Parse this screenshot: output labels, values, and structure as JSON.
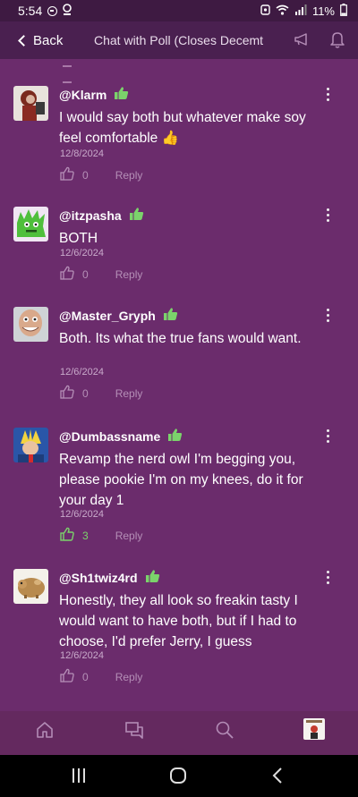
{
  "status": {
    "time": "5:54",
    "battery": "11%"
  },
  "appbar": {
    "back_label": "Back",
    "title": "Chat with Poll (Closes Decemt"
  },
  "comments": [
    {
      "username": "@Klarm",
      "text": "I would say both but whatever make soy feel comfortable 👍",
      "date": "12/8/2024",
      "likes": "0",
      "reply": "Reply",
      "liked": false
    },
    {
      "username": "@itzpasha",
      "text": "BOTH",
      "date": "12/6/2024",
      "likes": "0",
      "reply": "Reply",
      "liked": false
    },
    {
      "username": "@Master_Gryph",
      "text": "Both. Its what the true fans would want.",
      "date": "12/6/2024",
      "likes": "0",
      "reply": "Reply",
      "liked": false
    },
    {
      "username": "@Dumbassname",
      "text": "Revamp the nerd owl I'm begging you, please pookie I'm on my knees, do it for your day 1",
      "date": "12/6/2024",
      "likes": "3",
      "reply": "Reply",
      "liked": true
    },
    {
      "username": "@Sh1twiz4rd",
      "text": "Honestly, they all look so freakin tasty I would want to have both, but if I had to choose, I'd prefer Jerry, I guess",
      "date": "12/6/2024",
      "likes": "0",
      "reply": "Reply",
      "liked": false
    }
  ],
  "colors": {
    "background": "#6b2c6c",
    "appbar": "#4a2050",
    "badge_green": "#7bd36b",
    "meta": "#b58fb7"
  },
  "icons": {
    "badge": "thumbs-up-badge-icon",
    "like": "thumbs-up-outline-icon",
    "nav": [
      "home-icon",
      "chat-icon",
      "search-icon",
      "profile-avatar"
    ]
  }
}
